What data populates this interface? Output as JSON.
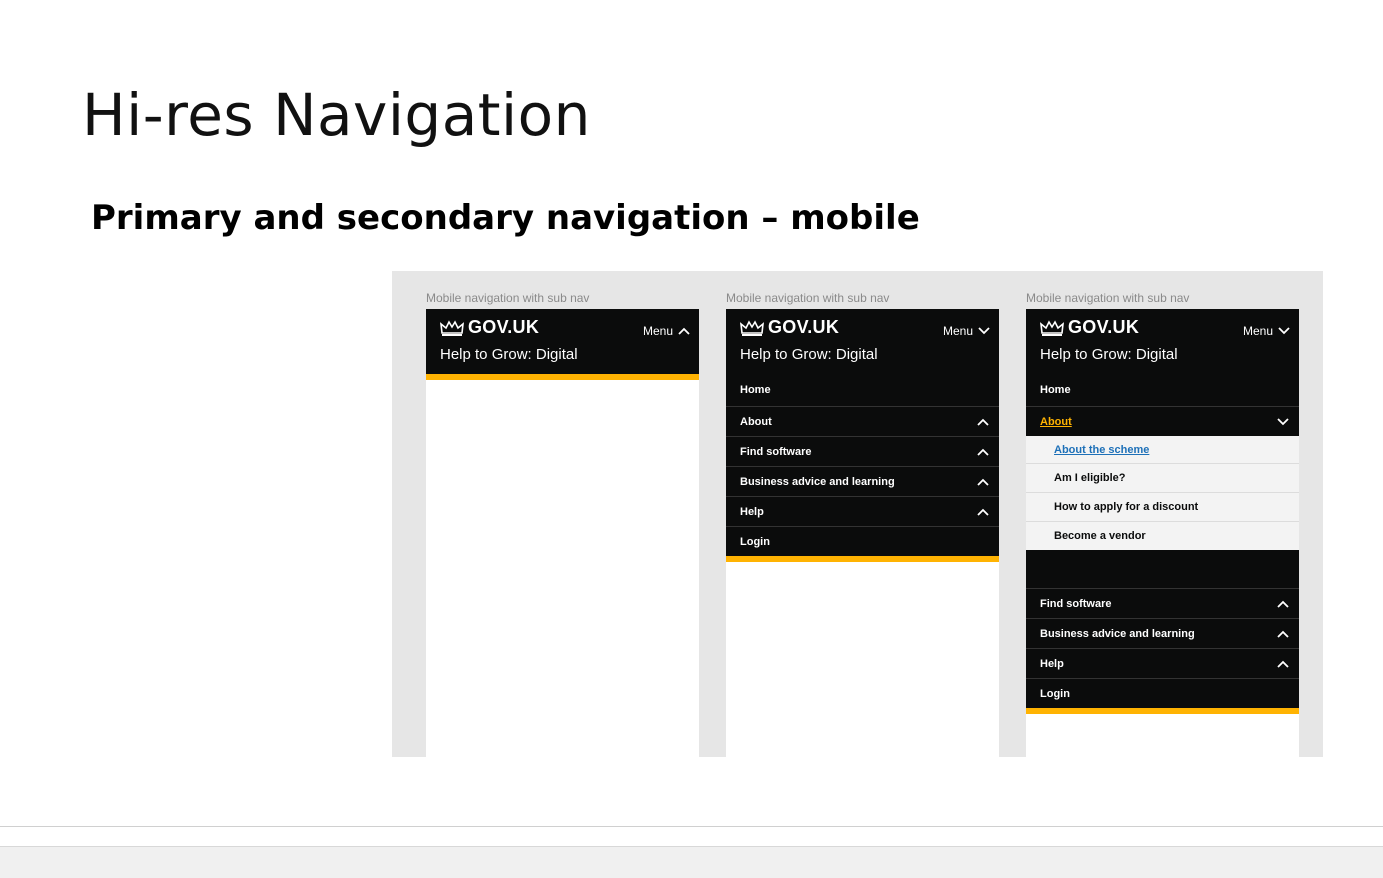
{
  "slide": {
    "title": "Hi-res Navigation",
    "subtitle": "Primary and secondary navigation – mobile"
  },
  "colors": {
    "header_bg": "#0b0c0c",
    "accent_yellow": "#ffb302",
    "link_blue": "#1d70b8",
    "panel_bg": "#e6e6e6"
  },
  "frames": [
    {
      "caption": "Mobile navigation with sub nav",
      "brand": "GOV.UK",
      "menu_label": "Menu",
      "menu_icon": "chevron-up-icon",
      "service": "Help to Grow: Digital"
    },
    {
      "caption": "Mobile navigation with sub nav",
      "brand": "GOV.UK",
      "menu_label": "Menu",
      "menu_icon": "chevron-down-icon",
      "service": "Help to Grow: Digital",
      "nav": [
        {
          "label": "Home"
        },
        {
          "label": "About",
          "icon": "chevron-up-icon"
        },
        {
          "label": "Find software",
          "icon": "chevron-up-icon"
        },
        {
          "label": "Business advice and learning",
          "icon": "chevron-up-icon"
        },
        {
          "label": "Help",
          "icon": "chevron-up-icon"
        },
        {
          "label": "Login"
        }
      ]
    },
    {
      "caption": "Mobile navigation with sub nav",
      "brand": "GOV.UK",
      "menu_label": "Menu",
      "menu_icon": "chevron-down-icon",
      "service": "Help to Grow: Digital",
      "nav_top": [
        {
          "label": "Home"
        },
        {
          "label": "About",
          "icon": "chevron-down-icon",
          "active": true
        }
      ],
      "sub_nav": [
        {
          "label": "About the scheme",
          "current": true
        },
        {
          "label": "Am I eligible?"
        },
        {
          "label": "How to apply for a discount"
        },
        {
          "label": "Become a vendor"
        }
      ],
      "nav_bottom": [
        {
          "label": "Find software",
          "icon": "chevron-up-icon"
        },
        {
          "label": "Business advice and learning",
          "icon": "chevron-up-icon"
        },
        {
          "label": "Help",
          "icon": "chevron-up-icon"
        },
        {
          "label": "Login"
        }
      ]
    }
  ]
}
